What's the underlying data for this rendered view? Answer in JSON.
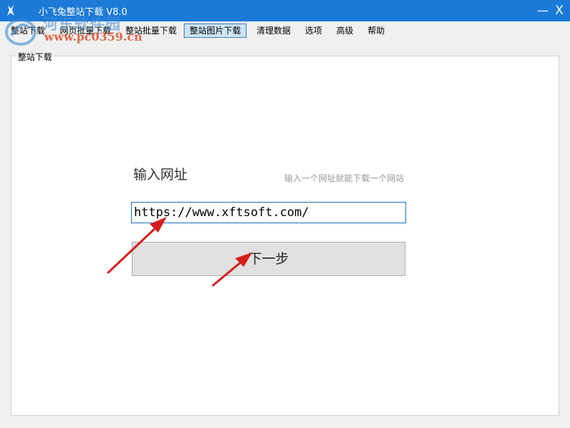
{
  "window": {
    "title": "小飞兔整站下载 V8.0",
    "minimize_symbol": "—",
    "close_symbol": "X"
  },
  "menu": {
    "items": [
      {
        "label": "整站下载",
        "active": false
      },
      {
        "label": "网页批量下载",
        "active": false
      },
      {
        "label": "整站批量下载",
        "active": false
      },
      {
        "label": "整站图片下载",
        "active": true
      },
      {
        "label": "清理数据",
        "active": false
      },
      {
        "label": "选项",
        "active": false
      },
      {
        "label": "高级",
        "active": false
      },
      {
        "label": "帮助",
        "active": false
      }
    ]
  },
  "watermark": {
    "site_name": "河东软件园",
    "site_url": "www.pc0359.cn"
  },
  "group": {
    "title": "整站下载"
  },
  "form": {
    "url_label": "输入网址",
    "hint": "输入一个网址就能下载一个网站",
    "url_value": "https://www.xftsoft.com/",
    "next_label": "下一步"
  },
  "colors": {
    "titlebar": "#1c7ad6",
    "active_menu_bg": "#cce4f7",
    "input_border": "#1a6fc1",
    "annotation_arrow": "#d61e1e"
  },
  "icons": {
    "app": "rabbit-icon",
    "annotation": "red-arrow-icon"
  }
}
